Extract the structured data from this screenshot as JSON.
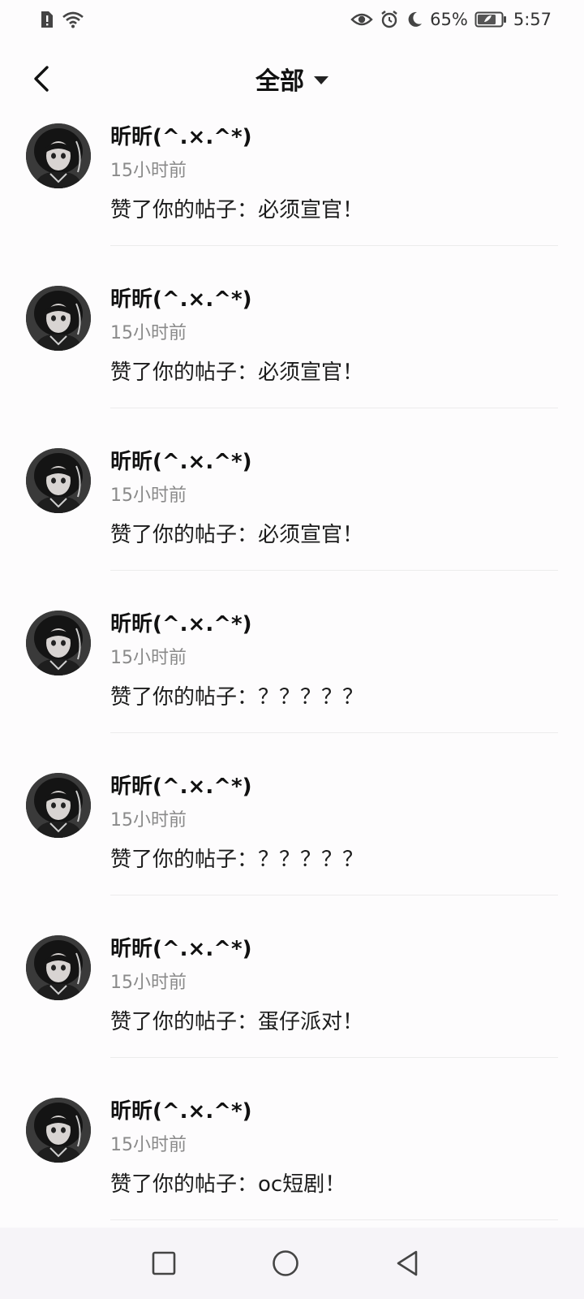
{
  "status_bar": {
    "battery": "65%",
    "time": "5:57",
    "icons": [
      "sim-alert-icon",
      "wifi-icon",
      "eye-icon",
      "alarm-icon",
      "moon-icon",
      "battery-icon"
    ]
  },
  "header": {
    "title": "全部",
    "back_icon": "chevron-left-icon",
    "dropdown_icon": "caret-down-icon"
  },
  "notifications": [
    {
      "name": "昕昕(^.×.^*)",
      "time": "15小时前",
      "message": "赞了你的帖子：必须宣官！"
    },
    {
      "name": "昕昕(^.×.^*)",
      "time": "15小时前",
      "message": "赞了你的帖子：必须宣官！"
    },
    {
      "name": "昕昕(^.×.^*)",
      "time": "15小时前",
      "message": "赞了你的帖子：必须宣官！"
    },
    {
      "name": "昕昕(^.×.^*)",
      "time": "15小时前",
      "message": "赞了你的帖子：？？？？？"
    },
    {
      "name": "昕昕(^.×.^*)",
      "time": "15小时前",
      "message": "赞了你的帖子：？？？？？"
    },
    {
      "name": "昕昕(^.×.^*)",
      "time": "15小时前",
      "message": "赞了你的帖子：蛋仔派对！"
    },
    {
      "name": "昕昕(^.×.^*)",
      "time": "15小时前",
      "message": "赞了你的帖子：oc短剧！"
    }
  ],
  "nav_bar": {
    "icons": [
      "recents-square-icon",
      "home-circle-icon",
      "back-triangle-icon"
    ]
  },
  "colors": {
    "background": "#fdfcfd",
    "secondary_text": "#8a8a8a",
    "divider": "#ececec",
    "nav_bar": "#f6f4f8"
  }
}
